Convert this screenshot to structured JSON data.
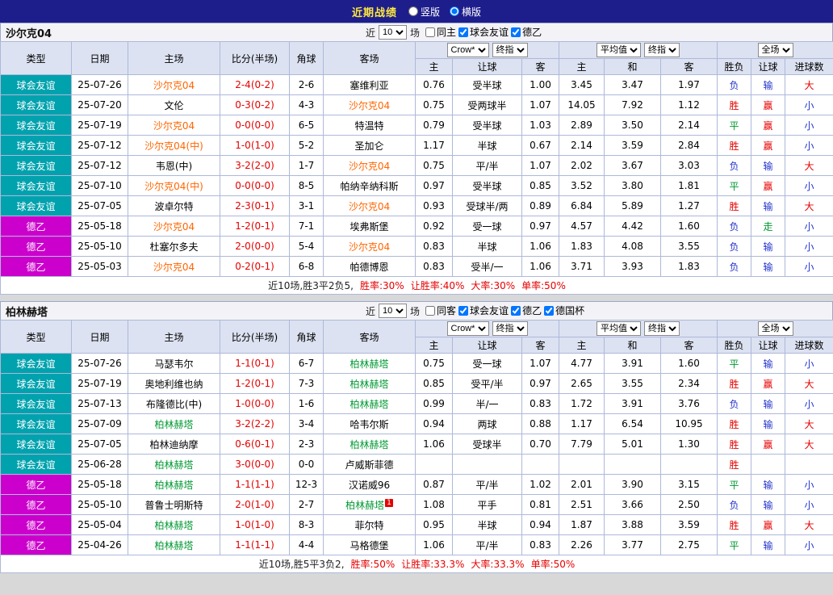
{
  "topbar": {
    "title": "近期战绩",
    "radios": [
      {
        "label": "竖版",
        "selected": false
      },
      {
        "label": "横版",
        "selected": true
      }
    ]
  },
  "type_colors": {
    "球会友谊": "#00a2ae",
    "德乙": "#cc00cc"
  },
  "result_colors": {
    "胜": "#e60000",
    "赢": "#e60000",
    "大": "#e60000",
    "平": "#009933",
    "走": "#009933",
    "负": "#2233cc",
    "输": "#2233cc",
    "小": "#2233cc"
  },
  "header_template": {
    "cols": [
      "类型",
      "日期",
      "主场",
      "比分(半场)",
      "角球",
      "客场"
    ],
    "odds_dropdowns": [
      "Crow*",
      "终指"
    ],
    "odds_sub": [
      "主",
      "让球",
      "客"
    ],
    "avg_dropdowns": [
      "平均值",
      "终指"
    ],
    "avg_sub": [
      "主",
      "和",
      "客"
    ],
    "result_dropdown": "全场",
    "result_sub": [
      "胜负",
      "让球",
      "进球数"
    ]
  },
  "tables": [
    {
      "team": "沙尔克04",
      "focus_color": "#ff6600",
      "filter": {
        "near_label": "近",
        "games_value": "10",
        "games_suffix": "场",
        "checkboxes": [
          {
            "label": "同主",
            "checked": false
          },
          {
            "label": "球会友谊",
            "checked": true
          },
          {
            "label": "德乙",
            "checked": true
          }
        ]
      },
      "rows": [
        {
          "type": "球会友谊",
          "date": "25-07-26",
          "home": "沙尔克04",
          "home_focus": true,
          "score": "2-4(0-2)",
          "corners": "2-6",
          "away": "塞维利亚",
          "away_focus": false,
          "odds": [
            "0.76",
            "受半球",
            "1.00"
          ],
          "avg": [
            "3.45",
            "3.47",
            "1.97"
          ],
          "results": [
            "负",
            "输",
            "大"
          ]
        },
        {
          "type": "球会友谊",
          "date": "25-07-20",
          "home": "文伦",
          "home_focus": false,
          "score": "0-3(0-2)",
          "corners": "4-3",
          "away": "沙尔克04",
          "away_focus": true,
          "odds": [
            "0.75",
            "受两球半",
            "1.07"
          ],
          "avg": [
            "14.05",
            "7.92",
            "1.12"
          ],
          "results": [
            "胜",
            "赢",
            "小"
          ]
        },
        {
          "type": "球会友谊",
          "date": "25-07-19",
          "home": "沙尔克04",
          "home_focus": true,
          "score": "0-0(0-0)",
          "corners": "6-5",
          "away": "特温特",
          "away_focus": false,
          "odds": [
            "0.79",
            "受半球",
            "1.03"
          ],
          "avg": [
            "2.89",
            "3.50",
            "2.14"
          ],
          "results": [
            "平",
            "赢",
            "小"
          ]
        },
        {
          "type": "球会友谊",
          "date": "25-07-12",
          "home": "沙尔克04(中)",
          "home_focus": true,
          "score": "1-0(1-0)",
          "corners": "5-2",
          "away": "圣加仑",
          "away_focus": false,
          "odds": [
            "1.17",
            "半球",
            "0.67"
          ],
          "avg": [
            "2.14",
            "3.59",
            "2.84"
          ],
          "results": [
            "胜",
            "赢",
            "小"
          ]
        },
        {
          "type": "球会友谊",
          "date": "25-07-12",
          "home": "韦恩(中)",
          "home_focus": false,
          "score": "3-2(2-0)",
          "corners": "1-7",
          "away": "沙尔克04",
          "away_focus": true,
          "odds": [
            "0.75",
            "平/半",
            "1.07"
          ],
          "avg": [
            "2.02",
            "3.67",
            "3.03"
          ],
          "results": [
            "负",
            "输",
            "大"
          ]
        },
        {
          "type": "球会友谊",
          "date": "25-07-10",
          "home": "沙尔克04(中)",
          "home_focus": true,
          "score": "0-0(0-0)",
          "corners": "8-5",
          "away": "帕纳辛纳科斯",
          "away_focus": false,
          "odds": [
            "0.97",
            "受半球",
            "0.85"
          ],
          "avg": [
            "3.52",
            "3.80",
            "1.81"
          ],
          "results": [
            "平",
            "赢",
            "小"
          ]
        },
        {
          "type": "球会友谊",
          "date": "25-07-05",
          "home": "波卓尔特",
          "home_focus": false,
          "score": "2-3(0-1)",
          "corners": "3-1",
          "away": "沙尔克04",
          "away_focus": true,
          "odds": [
            "0.93",
            "受球半/两",
            "0.89"
          ],
          "avg": [
            "6.84",
            "5.89",
            "1.27"
          ],
          "results": [
            "胜",
            "输",
            "大"
          ]
        },
        {
          "type": "德乙",
          "date": "25-05-18",
          "home": "沙尔克04",
          "home_focus": true,
          "score": "1-2(0-1)",
          "corners": "7-1",
          "away": "埃弗斯堡",
          "away_focus": false,
          "odds": [
            "0.92",
            "受一球",
            "0.97"
          ],
          "avg": [
            "4.57",
            "4.42",
            "1.60"
          ],
          "results": [
            "负",
            "走",
            "小"
          ]
        },
        {
          "type": "德乙",
          "date": "25-05-10",
          "home": "杜塞尔多夫",
          "home_focus": false,
          "score": "2-0(0-0)",
          "corners": "5-4",
          "away": "沙尔克04",
          "away_focus": true,
          "odds": [
            "0.83",
            "半球",
            "1.06"
          ],
          "avg": [
            "1.83",
            "4.08",
            "3.55"
          ],
          "results": [
            "负",
            "输",
            "小"
          ]
        },
        {
          "type": "德乙",
          "date": "25-05-03",
          "home": "沙尔克04",
          "home_focus": true,
          "score": "0-2(0-1)",
          "corners": "6-8",
          "away": "帕德博恩",
          "away_focus": false,
          "odds": [
            "0.83",
            "受半/一",
            "1.06"
          ],
          "avg": [
            "3.71",
            "3.93",
            "1.83"
          ],
          "results": [
            "负",
            "输",
            "小"
          ]
        }
      ],
      "summary": {
        "prefix": "近10场,胜3平2负5,",
        "stats": [
          "胜率:30%",
          "让胜率:40%",
          "大率:30%",
          "单率:50%"
        ]
      }
    },
    {
      "team": "柏林赫塔",
      "focus_color": "#009933",
      "filter": {
        "near_label": "近",
        "games_value": "10",
        "games_suffix": "场",
        "checkboxes": [
          {
            "label": "同客",
            "checked": false
          },
          {
            "label": "球会友谊",
            "checked": true
          },
          {
            "label": "德乙",
            "checked": true
          },
          {
            "label": "德国杯",
            "checked": true
          }
        ]
      },
      "rows": [
        {
          "type": "球会友谊",
          "date": "25-07-26",
          "home": "马瑟韦尔",
          "home_focus": false,
          "score": "1-1(0-1)",
          "corners": "6-7",
          "away": "柏林赫塔",
          "away_focus": true,
          "odds": [
            "0.75",
            "受一球",
            "1.07"
          ],
          "avg": [
            "4.77",
            "3.91",
            "1.60"
          ],
          "results": [
            "平",
            "输",
            "小"
          ]
        },
        {
          "type": "球会友谊",
          "date": "25-07-19",
          "home": "奥地利维也纳",
          "home_focus": false,
          "score": "1-2(0-1)",
          "corners": "7-3",
          "away": "柏林赫塔",
          "away_focus": true,
          "odds": [
            "0.85",
            "受平/半",
            "0.97"
          ],
          "avg": [
            "2.65",
            "3.55",
            "2.34"
          ],
          "results": [
            "胜",
            "赢",
            "大"
          ]
        },
        {
          "type": "球会友谊",
          "date": "25-07-13",
          "home": "布隆德比(中)",
          "home_focus": false,
          "score": "1-0(0-0)",
          "corners": "1-6",
          "away": "柏林赫塔",
          "away_focus": true,
          "odds": [
            "0.99",
            "半/一",
            "0.83"
          ],
          "avg": [
            "1.72",
            "3.91",
            "3.76"
          ],
          "results": [
            "负",
            "输",
            "小"
          ]
        },
        {
          "type": "球会友谊",
          "date": "25-07-09",
          "home": "柏林赫塔",
          "home_focus": true,
          "score": "3-2(2-2)",
          "corners": "3-4",
          "away": "哈韦尔斯",
          "away_focus": false,
          "odds": [
            "0.94",
            "两球",
            "0.88"
          ],
          "avg": [
            "1.17",
            "6.54",
            "10.95"
          ],
          "results": [
            "胜",
            "输",
            "大"
          ]
        },
        {
          "type": "球会友谊",
          "date": "25-07-05",
          "home": "柏林迪纳摩",
          "home_focus": false,
          "score": "0-6(0-1)",
          "corners": "2-3",
          "away": "柏林赫塔",
          "away_focus": true,
          "odds": [
            "1.06",
            "受球半",
            "0.70"
          ],
          "avg": [
            "7.79",
            "5.01",
            "1.30"
          ],
          "results": [
            "胜",
            "赢",
            "大"
          ]
        },
        {
          "type": "球会友谊",
          "date": "25-06-28",
          "home": "柏林赫塔",
          "home_focus": true,
          "score": "3-0(0-0)",
          "corners": "0-0",
          "away": "卢威斯菲德",
          "away_focus": false,
          "odds": [
            "",
            "",
            ""
          ],
          "avg": [
            "",
            "",
            ""
          ],
          "results": [
            "胜",
            "",
            ""
          ]
        },
        {
          "type": "德乙",
          "date": "25-05-18",
          "home": "柏林赫塔",
          "home_focus": true,
          "score": "1-1(1-1)",
          "corners": "12-3",
          "away": "汉诺威96",
          "away_focus": false,
          "odds": [
            "0.87",
            "平/半",
            "1.02"
          ],
          "avg": [
            "2.01",
            "3.90",
            "3.15"
          ],
          "results": [
            "平",
            "输",
            "小"
          ]
        },
        {
          "type": "德乙",
          "date": "25-05-10",
          "home": "普鲁士明斯特",
          "home_focus": false,
          "score": "2-0(1-0)",
          "corners": "2-7",
          "away": "柏林赫塔",
          "away_focus": true,
          "away_badge": "1",
          "odds": [
            "1.08",
            "平手",
            "0.81"
          ],
          "avg": [
            "2.51",
            "3.66",
            "2.50"
          ],
          "results": [
            "负",
            "输",
            "小"
          ]
        },
        {
          "type": "德乙",
          "date": "25-05-04",
          "home": "柏林赫塔",
          "home_focus": true,
          "score": "1-0(1-0)",
          "corners": "8-3",
          "away": "菲尔特",
          "away_focus": false,
          "odds": [
            "0.95",
            "半球",
            "0.94"
          ],
          "avg": [
            "1.87",
            "3.88",
            "3.59"
          ],
          "results": [
            "胜",
            "赢",
            "大"
          ]
        },
        {
          "type": "德乙",
          "date": "25-04-26",
          "home": "柏林赫塔",
          "home_focus": true,
          "score": "1-1(1-1)",
          "corners": "4-4",
          "away": "马格德堡",
          "away_focus": false,
          "odds": [
            "1.06",
            "平/半",
            "0.83"
          ],
          "avg": [
            "2.26",
            "3.77",
            "2.75"
          ],
          "results": [
            "平",
            "输",
            "小"
          ]
        }
      ],
      "summary": {
        "prefix": "近10场,胜5平3负2,",
        "stats": [
          "胜率:50%",
          "让胜率:33.3%",
          "大率:33.3%",
          "单率:50%"
        ]
      }
    }
  ]
}
